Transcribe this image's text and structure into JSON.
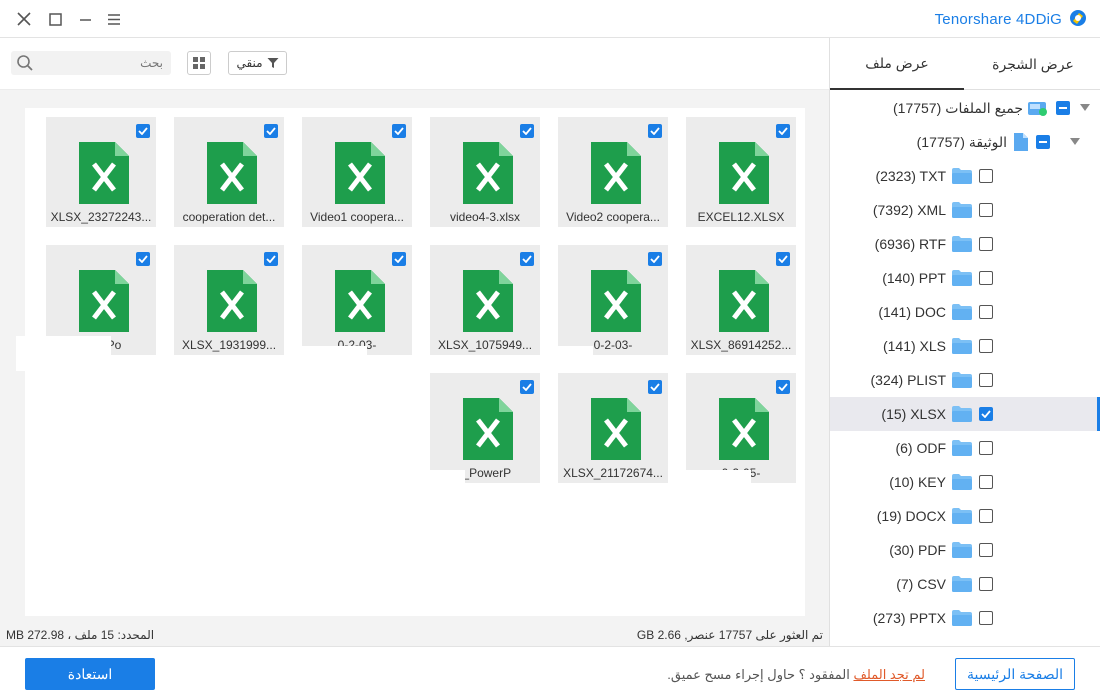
{
  "app": {
    "brand": "Tenorshare 4DDiG"
  },
  "colors": {
    "accent": "#1a7ee6",
    "excel_green": "#1e9e4c",
    "link": "#e05a2a"
  },
  "toolbar": {
    "search_placeholder": "بحث",
    "filter_label": "منقي"
  },
  "tabs": [
    {
      "label": "عرض الشجرة",
      "active": false
    },
    {
      "label": "عرض ملف",
      "active": true
    }
  ],
  "tree": {
    "root": {
      "label": "جميع الملفات",
      "count": "(17757)"
    },
    "doc": {
      "label": "الوثيقة",
      "count": "(17757)"
    },
    "items": [
      {
        "label": "(2323) TXT",
        "checked": false
      },
      {
        "label": "(7392) XML",
        "checked": false
      },
      {
        "label": "(6936) RTF",
        "checked": false
      },
      {
        "label": "(140) PPT",
        "checked": false
      },
      {
        "label": "(141) DOC",
        "checked": false
      },
      {
        "label": "(141) XLS",
        "checked": false
      },
      {
        "label": "(324) PLIST",
        "checked": false
      },
      {
        "label": "(15) XLSX",
        "checked": true,
        "selected": true
      },
      {
        "label": "(6) ODF",
        "checked": false
      },
      {
        "label": "(10) KEY",
        "checked": false
      },
      {
        "label": "(19) DOCX",
        "checked": false
      },
      {
        "label": "(30) PDF",
        "checked": false
      },
      {
        "label": "(7) CSV",
        "checked": false
      },
      {
        "label": "(273) PPTX",
        "checked": false
      }
    ]
  },
  "files": [
    {
      "name": "EXCEL12.XLSX"
    },
    {
      "name": "Video2 coopera..."
    },
    {
      "name": "video4-3.xlsx"
    },
    {
      "name": "Video1 coopera..."
    },
    {
      "name": "cooperation det..."
    },
    {
      "name": "XLSX_23272243..."
    },
    {
      "name": "XLSX_86914252..."
    },
    {
      "name": "0-2-03-"
    },
    {
      "name": "XLSX_1075949..."
    },
    {
      "name": "0-2-03-"
    },
    {
      "name": "XLSX_1931999..."
    },
    {
      "name": "owerPo"
    },
    {
      "name": "0-2-05-"
    },
    {
      "name": "XLSX_21172674..."
    },
    {
      "name": "ـ_PowerP"
    }
  ],
  "status": {
    "found": "تم العثور على 17757 عنصر, GB 2.66",
    "selected": "المحدد: 15 ملف ، MB 272.98"
  },
  "footer": {
    "recover": "استعادة",
    "home": "الصفحة الرئيسية",
    "hint_link": "لم تجد الملف",
    "hint_rest": " المفقود ؟ حاول إجراء مسح عميق."
  }
}
